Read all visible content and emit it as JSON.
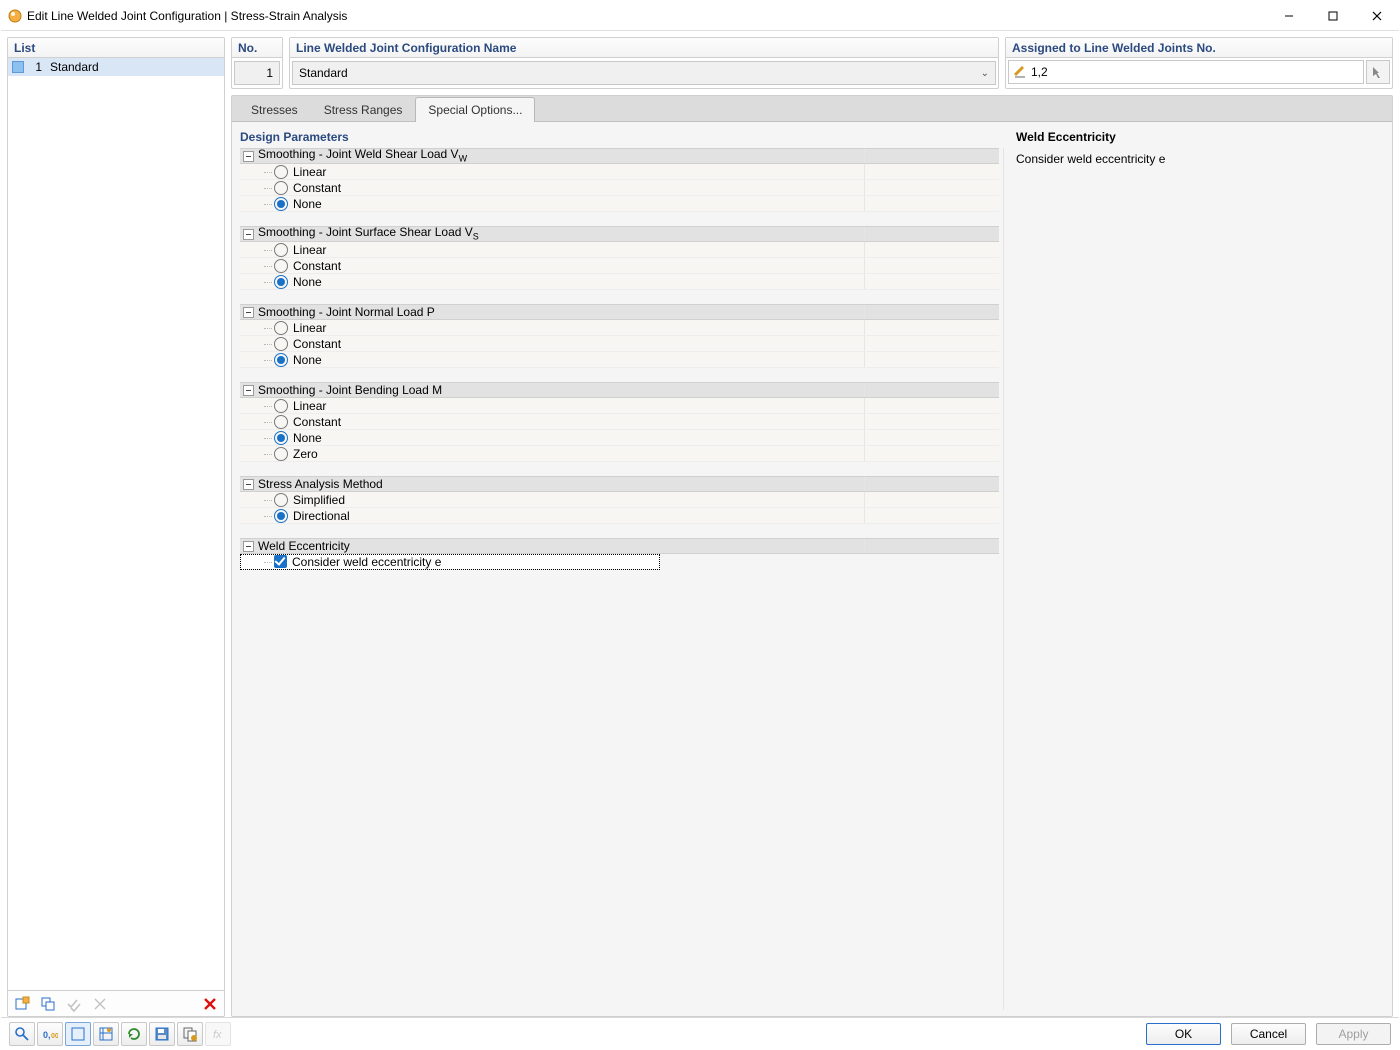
{
  "title": "Edit Line Welded Joint Configuration | Stress-Strain Analysis",
  "left": {
    "header": "List",
    "item_number": "1",
    "item_name": "Standard"
  },
  "fields": {
    "no_header": "No.",
    "no_value": "1",
    "name_header": "Line Welded Joint Configuration Name",
    "name_value": "Standard",
    "assigned_header": "Assigned to Line Welded Joints No.",
    "assigned_value": "1,2"
  },
  "tabs": {
    "t1": "Stresses",
    "t2": "Stress Ranges",
    "t3": "Special Options..."
  },
  "section_title": "Design Parameters",
  "groups": {
    "g1": {
      "title": "Smoothing - Joint Weld Shear Load V",
      "sub": "W",
      "o1": "Linear",
      "o2": "Constant",
      "o3": "None"
    },
    "g2": {
      "title": "Smoothing - Joint Surface Shear Load V",
      "sub": "S",
      "o1": "Linear",
      "o2": "Constant",
      "o3": "None"
    },
    "g3": {
      "title": "Smoothing - Joint Normal Load P",
      "o1": "Linear",
      "o2": "Constant",
      "o3": "None"
    },
    "g4": {
      "title": "Smoothing - Joint Bending Load M",
      "o1": "Linear",
      "o2": "Constant",
      "o3": "None",
      "o4": "Zero"
    },
    "g5": {
      "title": "Stress Analysis Method",
      "o1": "Simplified",
      "o2": "Directional"
    },
    "g6": {
      "title": "Weld Eccentricity",
      "o1": "Consider weld eccentricity e"
    }
  },
  "help": {
    "title": "Weld Eccentricity",
    "text": "Consider weld eccentricity e"
  },
  "buttons": {
    "ok": "OK",
    "cancel": "Cancel",
    "apply": "Apply"
  }
}
